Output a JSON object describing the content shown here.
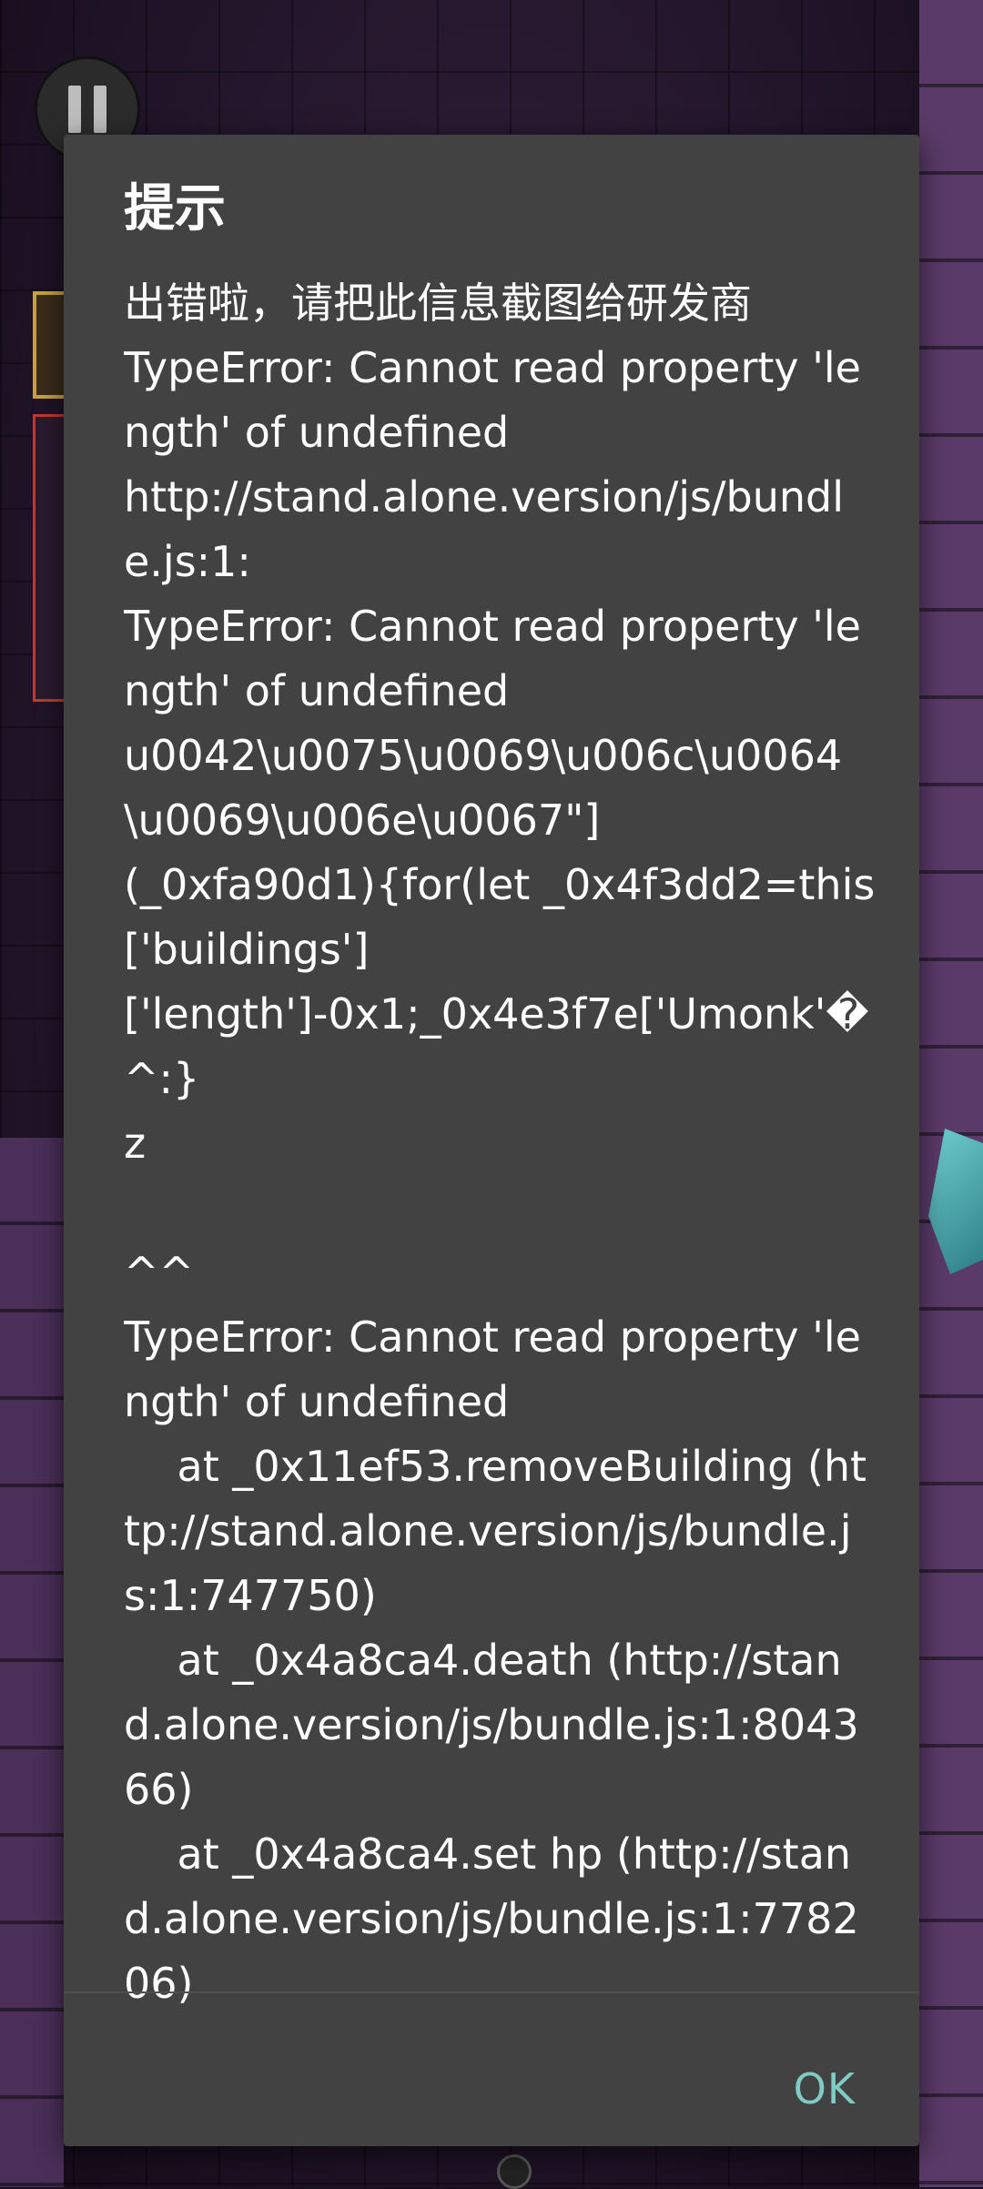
{
  "dialog": {
    "title": "提示",
    "message": "出错啦，请把此信息截图给研发商\nTypeError: Cannot read property 'length' of undefined\nhttp://stand.alone.version/js/bundle.js:1:\nTypeError: Cannot read property 'length' of undefined\nu0042\\u0075\\u0069\\u006c\\u0064\\u0069\\u006e\\u0067\"]\n(_0xfa90d1){for(let _0x4f3dd2=this['buildings']\n['length']-0x1;_0x4e3f7e['Umonk'�^:}\nz\n\n^^\nTypeError: Cannot read property 'length' of undefined\n    at _0x11ef53.removeBuilding (http://stand.alone.version/js/bundle.js:1:747750)\n    at _0x4a8ca4.death (http://stand.alone.version/js/bundle.js:1:804366)\n    at _0x4a8ca4.set hp (http://stand.alone.version/js/bundle.js:1:778206)",
    "ok_label": "OK"
  },
  "colors": {
    "dialog_bg": "#424242",
    "accent": "#80cbc4"
  },
  "icons": {
    "pause": "pause-icon"
  }
}
